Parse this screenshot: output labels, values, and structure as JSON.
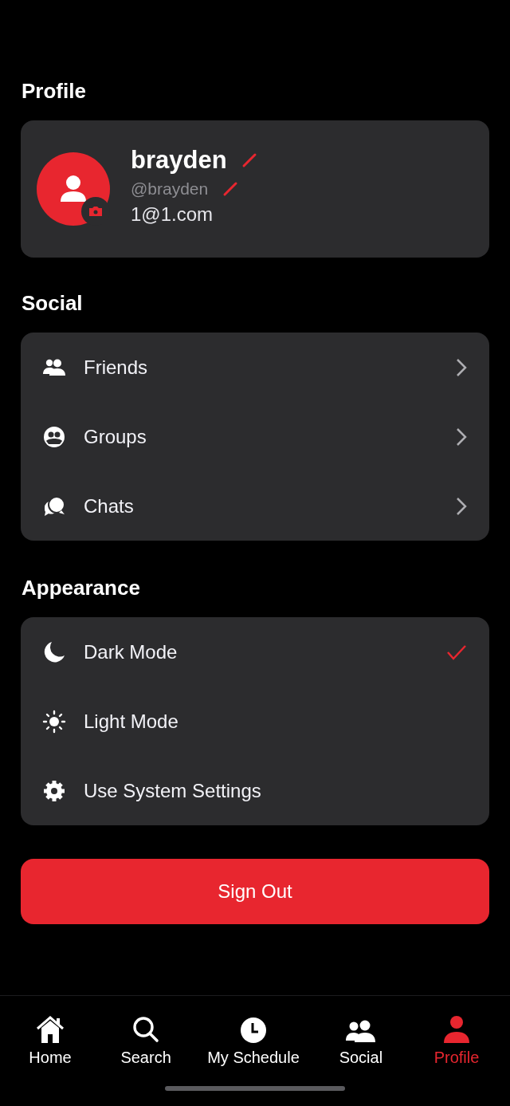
{
  "profile": {
    "heading": "Profile",
    "name": "brayden",
    "handle": "@brayden",
    "email": "1@1.com"
  },
  "social": {
    "heading": "Social",
    "items": [
      {
        "label": "Friends"
      },
      {
        "label": "Groups"
      },
      {
        "label": "Chats"
      }
    ]
  },
  "appearance": {
    "heading": "Appearance",
    "options": [
      {
        "label": "Dark Mode",
        "selected": true
      },
      {
        "label": "Light Mode",
        "selected": false
      },
      {
        "label": "Use System Settings",
        "selected": false
      }
    ]
  },
  "sign_out": "Sign Out",
  "tabs": [
    {
      "label": "Home",
      "selected": false
    },
    {
      "label": "Search",
      "selected": false
    },
    {
      "label": "My Schedule",
      "selected": false
    },
    {
      "label": "Social",
      "selected": false
    },
    {
      "label": "Profile",
      "selected": true
    }
  ]
}
